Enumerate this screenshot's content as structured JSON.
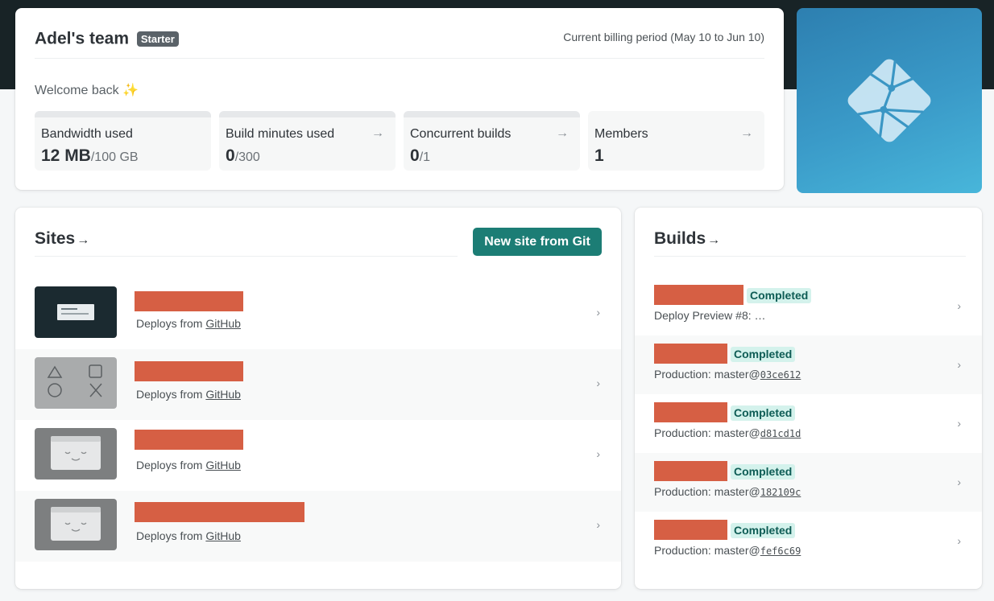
{
  "team": {
    "name": "Adel's team",
    "plan_badge": "Starter",
    "billing_period": "Current billing period (May 10 to Jun 10)",
    "welcome": "Welcome back ✨"
  },
  "stats": [
    {
      "label": "Bandwidth used",
      "value": "12 MB",
      "limit": "/100 GB",
      "has_arrow": false
    },
    {
      "label": "Build minutes used",
      "value": "0",
      "limit": "/300",
      "has_arrow": true
    },
    {
      "label": "Concurrent builds",
      "value": "0",
      "limit": "/1",
      "has_arrow": true
    },
    {
      "label": "Members",
      "value": "1",
      "limit": "",
      "has_arrow": true
    }
  ],
  "icons": {
    "arrow": "→",
    "chevron": "›"
  },
  "sites": {
    "title": "Sites",
    "new_site_button": "New site from Git",
    "items": [
      {
        "deploys_prefix": "Deploys from",
        "provider": "GitHub",
        "thumbnail": "dark-page-thumbnail"
      },
      {
        "deploys_prefix": "Deploys from",
        "provider": "GitHub",
        "thumbnail": "shapes-thumbnail"
      },
      {
        "deploys_prefix": "Deploys from",
        "provider": "GitHub",
        "thumbnail": "placeholder-face-thumbnail"
      },
      {
        "deploys_prefix": "Deploys from",
        "provider": "GitHub",
        "thumbnail": "placeholder-face-thumbnail"
      }
    ]
  },
  "builds": {
    "title": "Builds",
    "items": [
      {
        "status": "Completed",
        "context": "Deploy Preview #8: …",
        "hash": ""
      },
      {
        "status": "Completed",
        "context": "Production: master@",
        "hash": "03ce612"
      },
      {
        "status": "Completed",
        "context": "Production: master@",
        "hash": "d81cd1d"
      },
      {
        "status": "Completed",
        "context": "Production: master@",
        "hash": "182109c"
      },
      {
        "status": "Completed",
        "context": "Production: master@",
        "hash": "fef6c69"
      }
    ]
  },
  "colors": {
    "header_band": "#182326",
    "primary_button": "#1c7d75",
    "status_completed_bg": "#d4f2ec",
    "status_completed_text": "#0e5c55",
    "redaction": "#d65f44"
  }
}
